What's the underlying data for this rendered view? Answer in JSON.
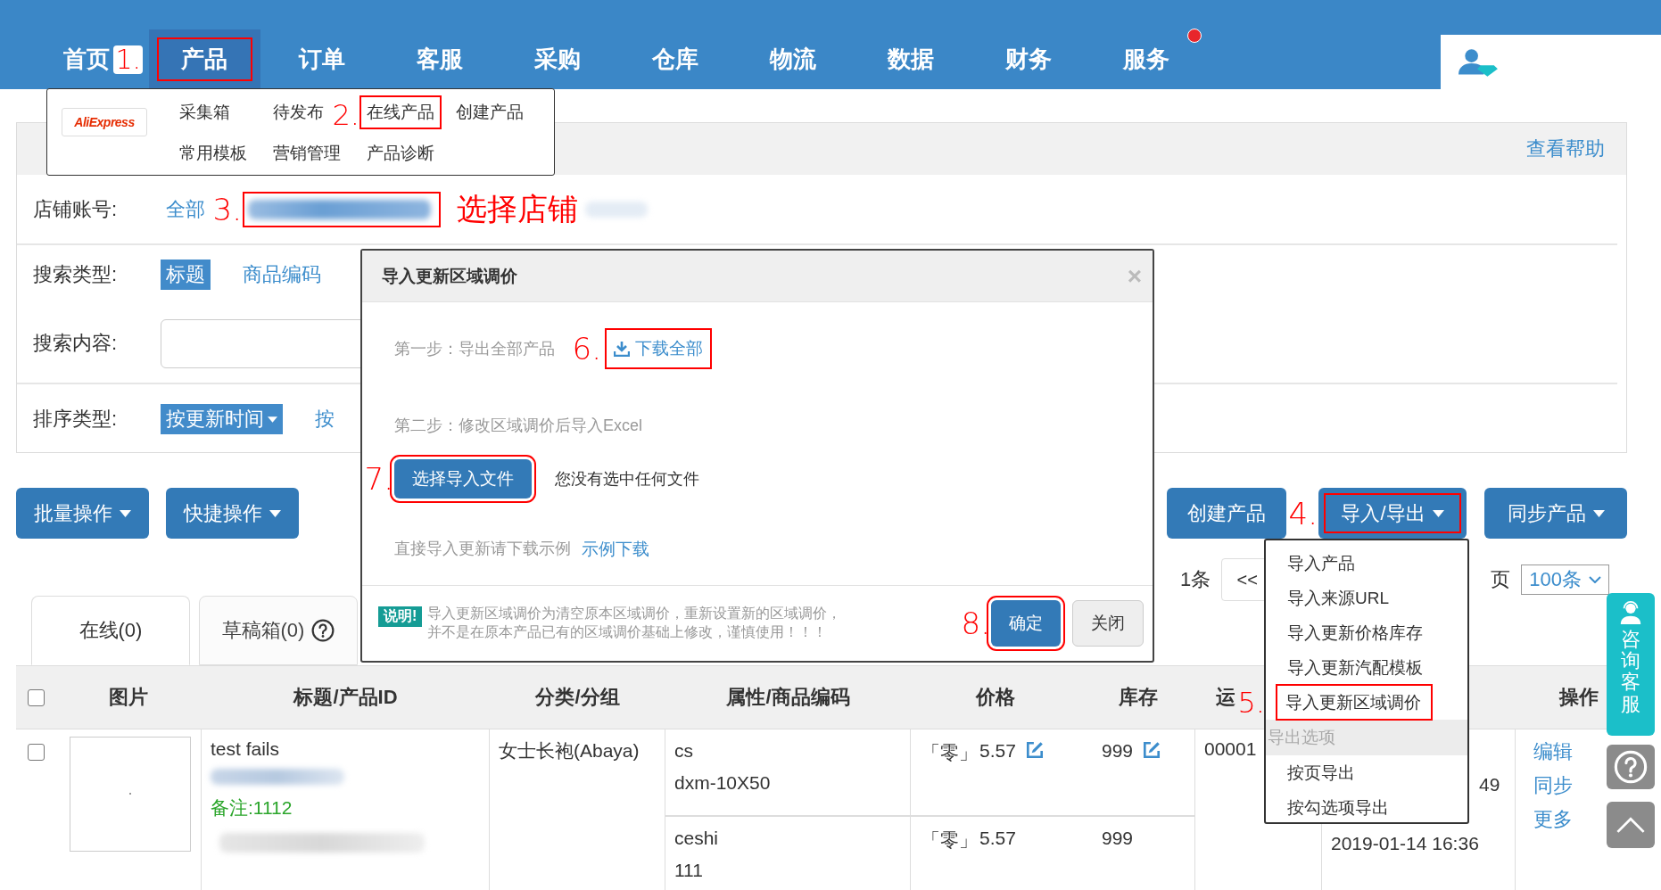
{
  "nav": {
    "items": [
      {
        "label": "首页",
        "selected": false,
        "highlighted": false,
        "notification": false
      },
      {
        "label": "产品",
        "selected": true,
        "highlighted": true,
        "marker": "1.",
        "notification": false
      },
      {
        "label": "订单",
        "selected": false,
        "highlighted": false,
        "notification": false
      },
      {
        "label": "客服",
        "selected": false,
        "highlighted": false,
        "notification": false
      },
      {
        "label": "采购",
        "selected": false,
        "highlighted": false,
        "notification": false
      },
      {
        "label": "仓库",
        "selected": false,
        "highlighted": false,
        "notification": false
      },
      {
        "label": "物流",
        "selected": false,
        "highlighted": false,
        "notification": false
      },
      {
        "label": "数据",
        "selected": false,
        "highlighted": false,
        "notification": false
      },
      {
        "label": "财务",
        "selected": false,
        "highlighted": false,
        "notification": false
      },
      {
        "label": "服务",
        "selected": false,
        "highlighted": false,
        "notification": true
      }
    ]
  },
  "product_menu": {
    "logo": "AliExpress",
    "links": [
      {
        "label": "采集箱",
        "highlighted": false
      },
      {
        "label": "待发布",
        "highlighted": false
      },
      {
        "label": "在线产品",
        "highlighted": true,
        "marker": "2."
      },
      {
        "label": "创建产品",
        "highlighted": false
      },
      {
        "label": "常用模板",
        "highlighted": false
      },
      {
        "label": "营销管理",
        "highlighted": false
      },
      {
        "label": "产品诊断",
        "highlighted": false
      }
    ]
  },
  "filter_panel": {
    "help_link": "查看帮助",
    "store": {
      "label": "店铺账号:",
      "options": [
        {
          "label": "全部",
          "selected": false
        }
      ],
      "marker": "3.",
      "highlighted": true,
      "note": "选择店铺"
    },
    "search_type": {
      "label": "搜索类型:",
      "options": [
        {
          "label": "标题",
          "selected": true
        },
        {
          "label": "商品编码",
          "selected": false
        }
      ]
    },
    "search_content": {
      "label": "搜索内容:"
    },
    "sort": {
      "label": "排序类型:",
      "options": [
        {
          "label": "按更新时间",
          "selected": true,
          "dropdown": true
        },
        {
          "label": "按",
          "selected": false,
          "dropdown": false
        }
      ]
    }
  },
  "toolbar": {
    "left": [
      {
        "label": "批量操作",
        "dropdown": true,
        "highlighted": false
      },
      {
        "label": "快捷操作",
        "dropdown": true,
        "highlighted": false
      }
    ],
    "right": [
      {
        "label": "创建产品",
        "dropdown": false,
        "highlighted": false
      },
      {
        "label": "导入/导出",
        "dropdown": true,
        "highlighted": true,
        "marker": "4."
      },
      {
        "label": "同步产品",
        "dropdown": true,
        "highlighted": false
      }
    ]
  },
  "tabs": [
    {
      "label": "在线(0)",
      "selected": true,
      "help": false
    },
    {
      "label": "草稿箱(0)",
      "selected": false,
      "help": true
    }
  ],
  "pagination": {
    "total": "1条",
    "prev": "<<",
    "per_page_label": "页",
    "per_page": "100条"
  },
  "table": {
    "header_checked": false,
    "columns": [
      "图片",
      "标题/产品ID",
      "分类/分组",
      "属性/商品编码",
      "价格",
      "库存",
      "运"
    ],
    "actions_column": "操作",
    "rows": [
      {
        "checked": false,
        "title": "test fails",
        "note": "备注:1112",
        "category": "女士长袍(Abaya)",
        "variants": [
          {
            "attribute": "cs",
            "code": "dxm-10X50",
            "price_tag": "「零」",
            "price": "5.57",
            "price_editable": true,
            "stock": "999",
            "stock_editable": true
          },
          {
            "attribute": "ceshi",
            "code": "111",
            "price_tag": "「零」",
            "price": "5.57",
            "price_editable": false,
            "stock": "999",
            "stock_editable": false
          }
        ],
        "shipping": "00001",
        "column_9": [
          "49",
          "2019-01-14 16:36"
        ],
        "actions": [
          "编辑",
          "同步",
          "更多"
        ]
      }
    ]
  },
  "modal": {
    "title": "导入更新区域调价",
    "close": "×",
    "step1": {
      "text": "第一步：导出全部产品",
      "link": "下载全部",
      "marker": "6.",
      "highlighted": true
    },
    "step2": {
      "text": "第二步：修改区域调价后导入Excel",
      "button": "选择导入文件",
      "marker": "7.",
      "highlighted": true,
      "file_status": "您没有选中任何文件"
    },
    "sample": {
      "text": "直接导入更新请下载示例",
      "link": "示例下载"
    },
    "notice": {
      "badge": "说明!",
      "lines": [
        "导入更新区域调价为清空原本区域调价，重新设置新的区域调价，",
        "并不是在原本产品已有的区域调价基础上修改，谨慎使用！！！"
      ]
    },
    "buttons": [
      {
        "label": "确定",
        "kind": "primary",
        "highlighted": true,
        "marker": "8."
      },
      {
        "label": "关闭",
        "kind": "default",
        "highlighted": false
      }
    ]
  },
  "export_menu": {
    "items": [
      {
        "kind": "item",
        "label": "导入产品",
        "highlighted": false
      },
      {
        "kind": "item",
        "label": "导入来源URL",
        "highlighted": false
      },
      {
        "kind": "item",
        "label": "导入更新价格库存",
        "highlighted": false
      },
      {
        "kind": "item",
        "label": "导入更新汽配模板",
        "highlighted": false
      },
      {
        "kind": "item",
        "label": "导入更新区域调价",
        "highlighted": true,
        "marker": "5."
      },
      {
        "kind": "header",
        "label": "导出选项"
      },
      {
        "kind": "item",
        "label": "按页导出",
        "highlighted": false
      },
      {
        "kind": "item",
        "label": "按勾选项导出",
        "highlighted": false
      }
    ]
  },
  "side_widget": {
    "label": "咨询客服"
  }
}
